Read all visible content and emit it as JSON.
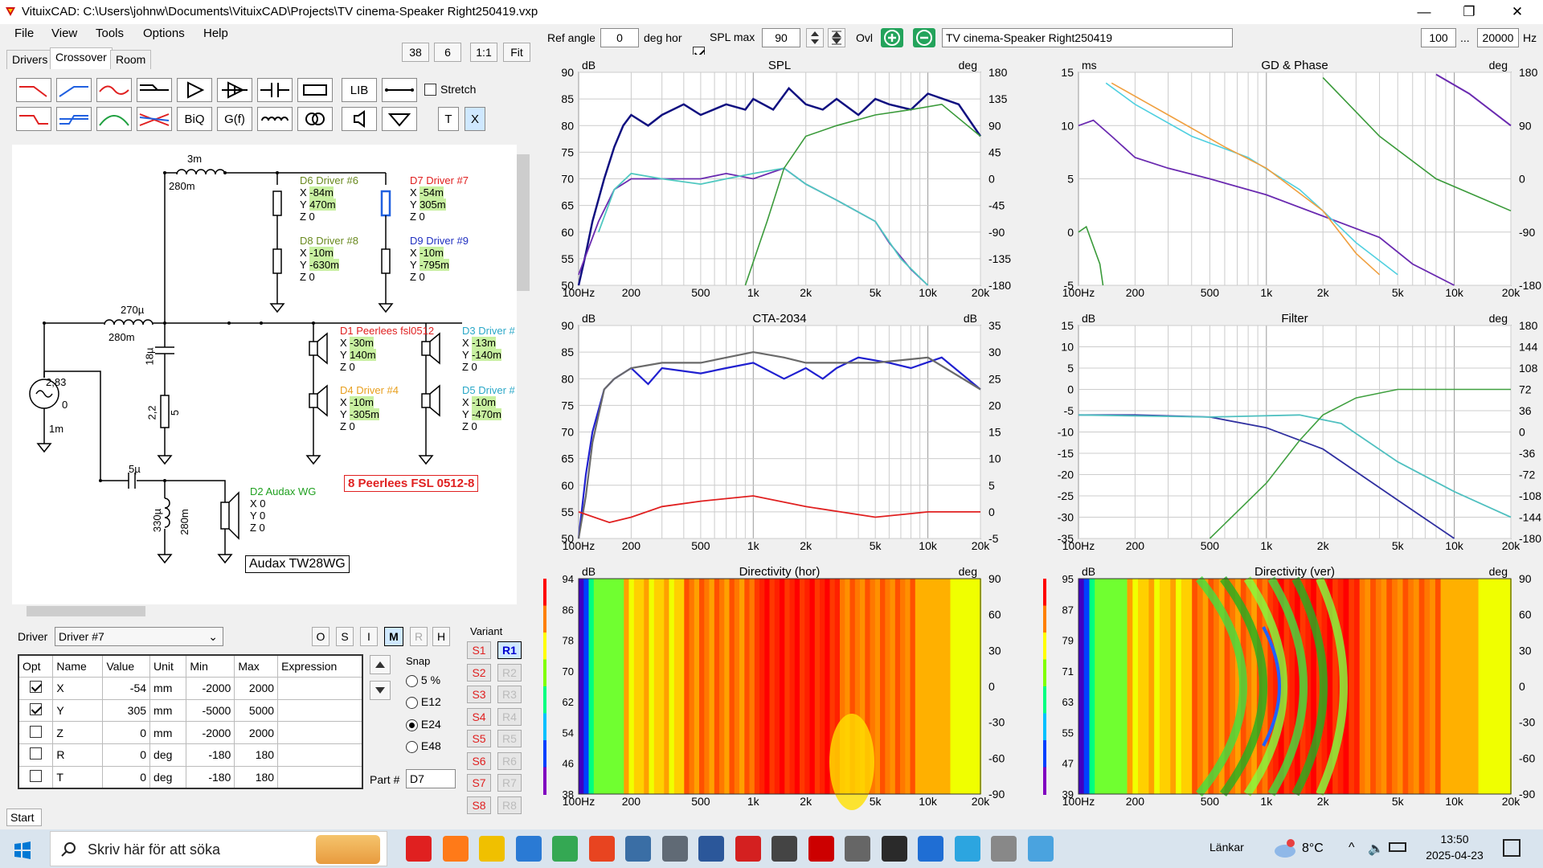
{
  "window": {
    "title": "VituixCAD: C:\\Users\\johnw\\Documents\\VituixCAD\\Projects\\TV cinema-Speaker Right250419.vxp",
    "minimize": "—",
    "maximize": "❐",
    "close": "✕"
  },
  "menu": [
    "File",
    "View",
    "Tools",
    "Options",
    "Help"
  ],
  "tabs": [
    "Drivers",
    "Crossover",
    "Room"
  ],
  "toolbar_top": {
    "v1": "38",
    "v2": "6",
    "v3": "1:1",
    "v4": "Fit"
  },
  "tool_text": {
    "lib": "LIB",
    "stretch": "Stretch",
    "biq": "BiQ",
    "gf": "G(f)",
    "t": "T",
    "x": "X"
  },
  "controls": {
    "ref_angle_label": "Ref angle",
    "ref_angle": "0",
    "deg_hor": "deg hor",
    "splmax_label": "SPL max",
    "splmax": "90",
    "ovl": "Ovl",
    "project_name": "TV cinema-Speaker Right250419",
    "freq_min": "100",
    "dots": "...",
    "freq_max": "20000",
    "hz": "Hz"
  },
  "schematic": {
    "labels": [
      {
        "t": "3m",
        "c": "#000"
      },
      {
        "t": "280m",
        "c": "#000"
      },
      {
        "t": "270µ",
        "c": "#000"
      },
      {
        "t": "280m",
        "c": "#000"
      },
      {
        "t": "18µ",
        "c": "#000"
      },
      {
        "t": "2,2",
        "c": "#000"
      },
      {
        "t": "5",
        "c": "#000"
      },
      {
        "t": "2,83",
        "c": "#000"
      },
      {
        "t": "0",
        "c": "#000"
      },
      {
        "t": "1m",
        "c": "#000"
      },
      {
        "t": "5µ",
        "c": "#000"
      },
      {
        "t": "330µ",
        "c": "#000"
      },
      {
        "t": "280m",
        "c": "#000"
      }
    ],
    "drivers": [
      {
        "name": "D6 Driver #6",
        "color": "#6a8a20",
        "x": "-84m",
        "y": "470m",
        "z": "Z 0"
      },
      {
        "name": "D7 Driver #7",
        "color": "#e02020",
        "x": "-54m",
        "y": "305m",
        "z": "Z 0"
      },
      {
        "name": "D8 Driver #8",
        "color": "#6a8a20",
        "x": "-10m",
        "y": "-630m",
        "z": "Z 0"
      },
      {
        "name": "D9 Driver #9",
        "color": "#2030c0",
        "x": "-10m",
        "y": "-795m",
        "z": "Z 0"
      },
      {
        "name": "D1 Peerlees fsl0512",
        "color": "#e02020",
        "x": "-30m",
        "y": "140m",
        "z": "Z 0"
      },
      {
        "name": "D3 Driver #",
        "color": "#2aa8c8",
        "x": "-13m",
        "y": "-140m",
        "z": "Z 0"
      },
      {
        "name": "D4 Driver #4",
        "color": "#e8a020",
        "x": "-10m",
        "y": "-305m",
        "z": "Z 0"
      },
      {
        "name": "D5 Driver #",
        "color": "#2aa8c8",
        "x": "-10m",
        "y": "-470m",
        "z": "Z 0"
      },
      {
        "name": "D2 Audax WG",
        "color": "#20a020",
        "x": "X 0",
        "y": "Y 0",
        "z": "Z 0"
      }
    ],
    "note1": "8 Peerlees FSL 0512-8",
    "note2": "Audax TW28WG"
  },
  "driver_panel": {
    "label": "Driver",
    "selected": "Driver #7",
    "mode_btns": [
      "O",
      "S",
      "I",
      "M",
      "R",
      "H"
    ],
    "headers": [
      "Opt",
      "Name",
      "Value",
      "Unit",
      "Min",
      "Max",
      "Expression"
    ],
    "rows": [
      {
        "checked": true,
        "name": "X",
        "value": "-54",
        "unit": "mm",
        "min": "-2000",
        "max": "2000"
      },
      {
        "checked": true,
        "name": "Y",
        "value": "305",
        "unit": "mm",
        "min": "-5000",
        "max": "5000"
      },
      {
        "checked": false,
        "name": "Z",
        "value": "0",
        "unit": "mm",
        "min": "-2000",
        "max": "2000"
      },
      {
        "checked": false,
        "name": "R",
        "value": "0",
        "unit": "deg",
        "min": "-180",
        "max": "180"
      },
      {
        "checked": false,
        "name": "T",
        "value": "0",
        "unit": "deg",
        "min": "-180",
        "max": "180"
      }
    ],
    "snap_label": "Snap",
    "snap": [
      "5 %",
      "E12",
      "E24",
      "E48"
    ],
    "snap_selected": 2,
    "part_label": "Part #",
    "part": "D7",
    "variant_label": "Variant",
    "s": [
      "S1",
      "S2",
      "S3",
      "S4",
      "S5",
      "S6",
      "S7",
      "S8"
    ],
    "r": [
      "R1",
      "R2",
      "R3",
      "R4",
      "R5",
      "R6",
      "R7",
      "R8"
    ],
    "start": "Start"
  },
  "plots": {
    "spl": {
      "title": "SPL",
      "yl": "dB",
      "yr": "deg",
      "left": [
        "90",
        "85",
        "80",
        "75",
        "70",
        "65",
        "60",
        "55",
        "50"
      ],
      "right": [
        "180",
        "135",
        "90",
        "45",
        "0",
        "-45",
        "-90",
        "-135",
        "-180"
      ]
    },
    "gd": {
      "title": "GD & Phase",
      "yl": "ms",
      "yr": "deg",
      "left": [
        "15",
        "10",
        "5",
        "0",
        "-5"
      ],
      "right": [
        "180",
        "90",
        "0",
        "-90",
        "-180"
      ]
    },
    "cta": {
      "title": "CTA-2034",
      "yl": "dB",
      "yr": "dB",
      "left": [
        "90",
        "85",
        "80",
        "75",
        "70",
        "65",
        "60",
        "55",
        "50"
      ],
      "right": [
        "35",
        "30",
        "25",
        "20",
        "15",
        "10",
        "5",
        "0",
        "-5"
      ]
    },
    "filter": {
      "title": "Filter",
      "yl": "dB",
      "yr": "deg",
      "left": [
        "15",
        "10",
        "5",
        "0",
        "-5",
        "-10",
        "-15",
        "-20",
        "-25",
        "-30",
        "-35"
      ],
      "right": [
        "180",
        "144",
        "108",
        "72",
        "36",
        "0",
        "-36",
        "-72",
        "-108",
        "-144",
        "-180"
      ]
    },
    "dirh": {
      "title": "Directivity (hor)",
      "yl": "dB",
      "yr": "deg",
      "left": [
        "94",
        "86",
        "78",
        "70",
        "62",
        "54",
        "46",
        "38"
      ],
      "right": [
        "90",
        "60",
        "30",
        "0",
        "-30",
        "-60",
        "-90"
      ]
    },
    "dirv": {
      "title": "Directivity (ver)",
      "yl": "dB",
      "yr": "deg",
      "left": [
        "95",
        "87",
        "79",
        "71",
        "63",
        "55",
        "47",
        "39"
      ],
      "right": [
        "90",
        "60",
        "30",
        "0",
        "-30",
        "-60",
        "-90"
      ]
    },
    "xticks": [
      "100Hz",
      "200",
      "500",
      "1k",
      "2k",
      "5k",
      "10k",
      "20k"
    ]
  },
  "taskbar": {
    "search": "Skriv här för att söka",
    "links": "Länkar",
    "temp": "8°C",
    "time": "13:50",
    "date": "2025-04-23"
  }
}
